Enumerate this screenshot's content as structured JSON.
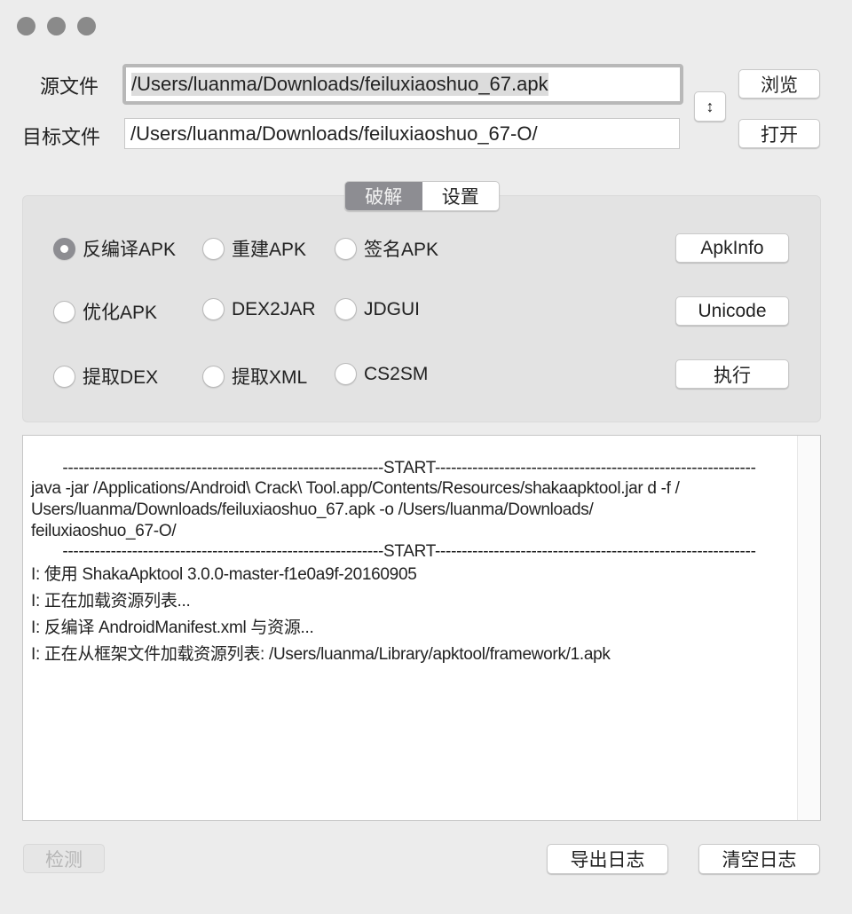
{
  "window": {
    "controls": [
      "close",
      "minimize",
      "zoom"
    ]
  },
  "source": {
    "label": "源文件",
    "value": "/Users/luanma/Downloads/feiluxiaoshuo_67.apk",
    "browse_label": "浏览"
  },
  "target": {
    "label": "目标文件",
    "value": "/Users/luanma/Downloads/feiluxiaoshuo_67-O/",
    "open_label": "打开"
  },
  "swap_label": "↕",
  "tabs": [
    {
      "label": "破解",
      "selected": true
    },
    {
      "label": "设置",
      "selected": false
    }
  ],
  "options": [
    {
      "label": "反编译APK",
      "selected": true
    },
    {
      "label": "重建APK",
      "selected": false
    },
    {
      "label": "签名APK",
      "selected": false
    },
    {
      "label": "优化APK",
      "selected": false
    },
    {
      "label": "DEX2JAR",
      "selected": false
    },
    {
      "label": "JDGUI",
      "selected": false
    },
    {
      "label": "提取DEX",
      "selected": false
    },
    {
      "label": "提取XML",
      "selected": false
    },
    {
      "label": "CS2SM",
      "selected": false
    }
  ],
  "actions": {
    "apkinfo": "ApkInfo",
    "unicode": "Unicode",
    "execute": "执行"
  },
  "log": {
    "sep1": "------------------------------------------------------------START------------------------------------------------------------",
    "cmd1": "java -jar /Applications/Android\\ Crack\\ Tool.app/Contents/Resources/shakaapktool.jar d -f /",
    "cmd2": "Users/luanma/Downloads/feiluxiaoshuo_67.apk -o /Users/luanma/Downloads/",
    "cmd3": "feiluxiaoshuo_67-O/",
    "sep2": "------------------------------------------------------------START------------------------------------------------------------",
    "l1": "I: 使用 ShakaApktool 3.0.0-master-f1e0a9f-20160905",
    "l2": "I: 正在加载资源列表...",
    "l3": "I: 反编译 AndroidManifest.xml 与资源...",
    "l4": "I: 正在从框架文件加载资源列表: /Users/luanma/Library/apktool/framework/1.apk"
  },
  "footer": {
    "check": "检测",
    "check_disabled": true,
    "export": "导出日志",
    "clear": "清空日志"
  }
}
